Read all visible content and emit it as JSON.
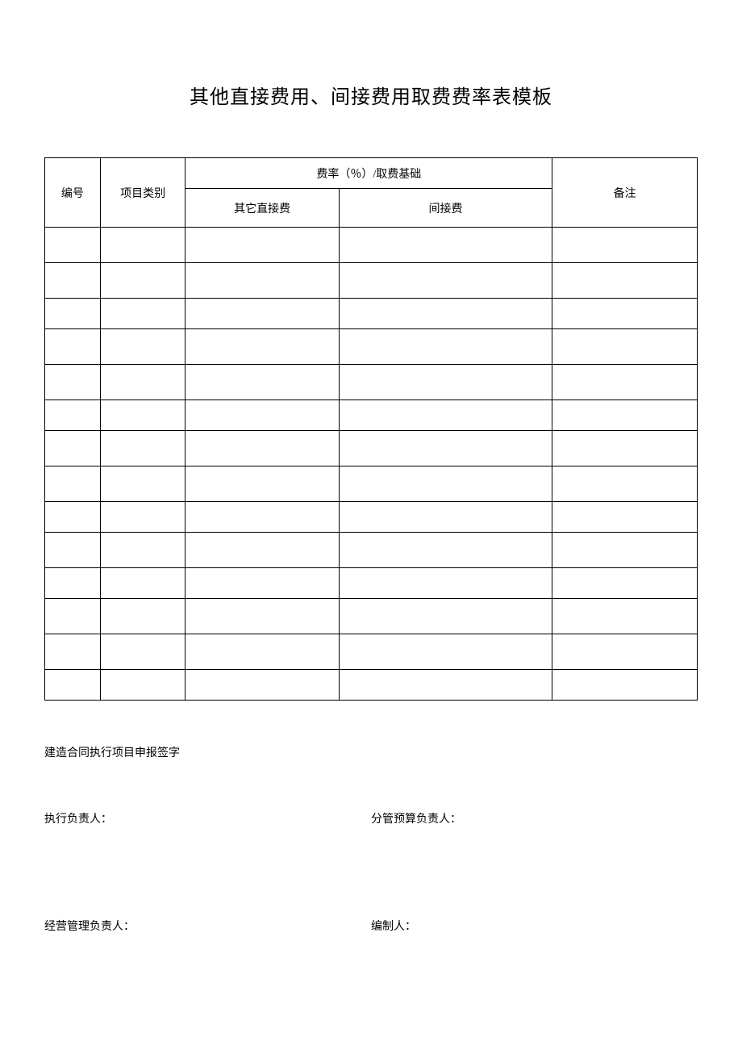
{
  "title": "其他直接费用、间接费用取费费率表模板",
  "table": {
    "headers": {
      "id": "编号",
      "category": "项目类别",
      "rate_group": "费率（％）/取费基础",
      "other_direct": "其它直接费",
      "indirect": "间接费",
      "notes": "备注"
    },
    "rows": [
      {
        "id": "",
        "category": "",
        "other": "",
        "indirect": "",
        "notes": ""
      },
      {
        "id": "",
        "category": "",
        "other": "",
        "indirect": "",
        "notes": ""
      },
      {
        "id": "",
        "category": "",
        "other": "",
        "indirect": "",
        "notes": ""
      },
      {
        "id": "",
        "category": "",
        "other": "",
        "indirect": "",
        "notes": ""
      },
      {
        "id": "",
        "category": "",
        "other": "",
        "indirect": "",
        "notes": ""
      },
      {
        "id": "",
        "category": "",
        "other": "",
        "indirect": "",
        "notes": ""
      },
      {
        "id": "",
        "category": "",
        "other": "",
        "indirect": "",
        "notes": ""
      },
      {
        "id": "",
        "category": "",
        "other": "",
        "indirect": "",
        "notes": ""
      },
      {
        "id": "",
        "category": "",
        "other": "",
        "indirect": "",
        "notes": ""
      },
      {
        "id": "",
        "category": "",
        "other": "",
        "indirect": "",
        "notes": ""
      },
      {
        "id": "",
        "category": "",
        "other": "",
        "indirect": "",
        "notes": ""
      },
      {
        "id": "",
        "category": "",
        "other": "",
        "indirect": "",
        "notes": ""
      },
      {
        "id": "",
        "category": "",
        "other": "",
        "indirect": "",
        "notes": ""
      },
      {
        "id": "",
        "category": "",
        "other": "",
        "indirect": "",
        "notes": ""
      }
    ]
  },
  "signatures": {
    "intro": "建造合同执行项目申报签字",
    "exec_lead": "执行负责人：",
    "budget_lead": "分管预算负责人：",
    "mgmt_lead": "经营管理负责人：",
    "author": "编制人："
  }
}
